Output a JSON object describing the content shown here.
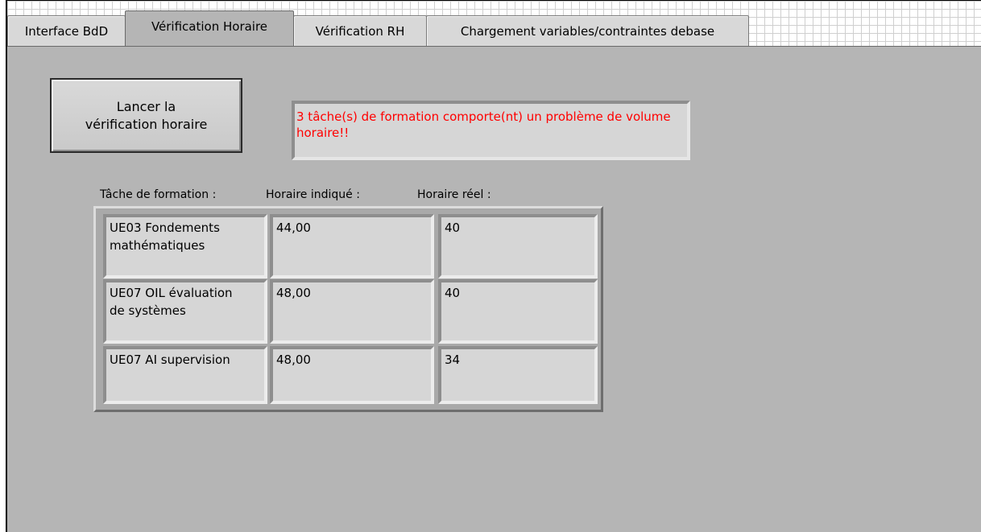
{
  "tabs": [
    {
      "label": "Interface BdD",
      "active": false
    },
    {
      "label": "Vérification Horaire",
      "active": true
    },
    {
      "label": "Vérification RH",
      "active": false
    },
    {
      "label": "Chargement variables/contraintes debase",
      "active": false
    }
  ],
  "launch_button": {
    "label": "Lancer la\nvérification horaire"
  },
  "message": {
    "text": "3 tâche(s) de formation comporte(nt) un problème de volume horaire!!",
    "color": "#ff0000"
  },
  "table": {
    "headers": [
      "Tâche de formation :",
      "Horaire indiqué :",
      "Horaire réel :"
    ],
    "rows": [
      {
        "task": "UE03 Fondements\nmathématiques",
        "indicated": "44,00",
        "real": "40"
      },
      {
        "task": "UE07 OIL évaluation\nde systèmes",
        "indicated": "48,00",
        "real": "40"
      },
      {
        "task": "UE07 AI supervision",
        "indicated": "48,00",
        "real": "34"
      }
    ]
  }
}
